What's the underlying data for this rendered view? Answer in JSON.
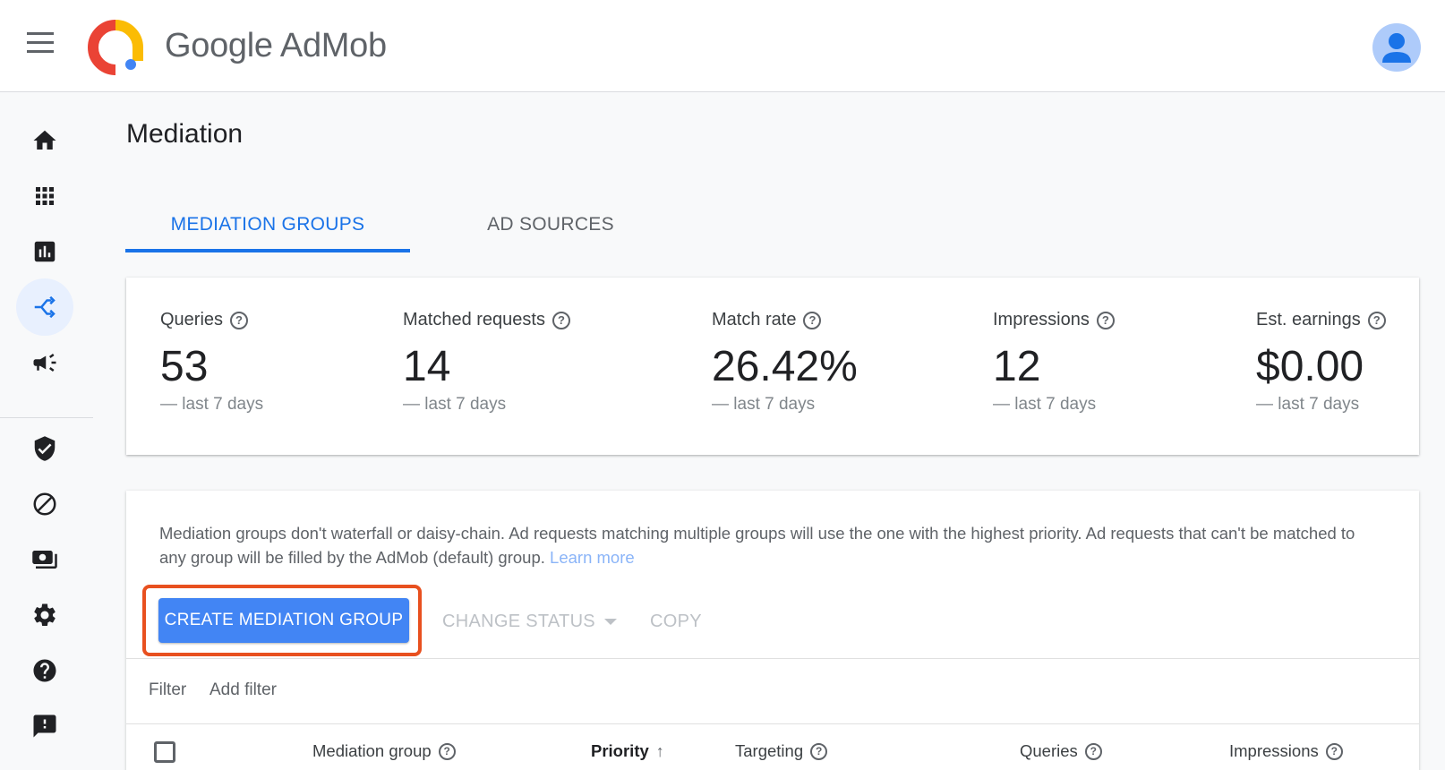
{
  "header": {
    "brand": "Google AdMob"
  },
  "page": {
    "title": "Mediation"
  },
  "tabs": [
    {
      "label": "MEDIATION GROUPS",
      "active": true
    },
    {
      "label": "AD SOURCES",
      "active": false
    }
  ],
  "stats": [
    {
      "label": "Queries",
      "value": "53",
      "period": "— last 7 days"
    },
    {
      "label": "Matched requests",
      "value": "14",
      "period": "— last 7 days"
    },
    {
      "label": "Match rate",
      "value": "26.42%",
      "period": "— last 7 days"
    },
    {
      "label": "Impressions",
      "value": "12",
      "period": "— last 7 days"
    },
    {
      "label": "Est. earnings",
      "value": "$0.00",
      "period": "— last 7 days"
    }
  ],
  "info": {
    "text": "Mediation groups don't waterfall or daisy-chain. Ad requests matching multiple groups will use the one with the highest priority. Ad requests that can't be matched to any group will be filled by the AdMob (default) group.",
    "link": "Learn more"
  },
  "actions": {
    "create": "CREATE MEDIATION GROUP",
    "change_status": "CHANGE STATUS",
    "copy": "COPY"
  },
  "filter": {
    "label": "Filter",
    "add": "Add filter"
  },
  "table": {
    "columns": [
      "Mediation group",
      "Priority",
      "Targeting",
      "Queries",
      "Impressions"
    ],
    "sort_column": "Priority"
  },
  "colors": {
    "accent": "#1a73e8",
    "button": "#4285f4",
    "highlight": "#e8501f"
  }
}
